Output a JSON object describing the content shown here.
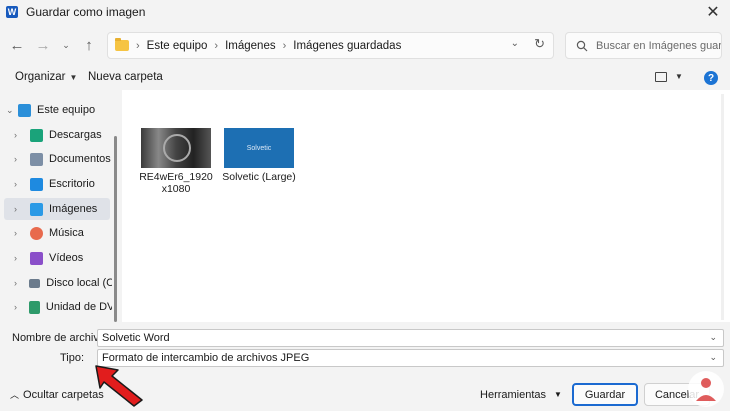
{
  "window": {
    "title": "Guardar como imagen",
    "app_icon": "W"
  },
  "nav": {
    "breadcrumbs": [
      "Este equipo",
      "Imágenes",
      "Imágenes guardadas"
    ],
    "search_placeholder": "Buscar en Imágenes guarda..."
  },
  "toolbar": {
    "organize": "Organizar",
    "new_folder": "Nueva carpeta",
    "help": "?"
  },
  "sidebar": {
    "items": [
      {
        "label": "Este equipo",
        "icon": "computer-icon",
        "color": "#2b8fd9"
      },
      {
        "label": "Descargas",
        "icon": "download-icon",
        "color": "#1aa37a"
      },
      {
        "label": "Documentos",
        "icon": "documents-icon",
        "color": "#7d8fa6"
      },
      {
        "label": "Escritorio",
        "icon": "desktop-icon",
        "color": "#1e8ae0"
      },
      {
        "label": "Imágenes",
        "icon": "pictures-icon",
        "color": "#2b9ae6"
      },
      {
        "label": "Música",
        "icon": "music-icon",
        "color": "#e86a4d"
      },
      {
        "label": "Vídeos",
        "icon": "videos-icon",
        "color": "#8a4fc9"
      },
      {
        "label": "Disco local (C:)",
        "icon": "drive-icon",
        "color": "#6b7b8c"
      },
      {
        "label": "Unidad de DVD",
        "icon": "dvd-icon",
        "color": "#2e9a6a"
      }
    ]
  },
  "files": [
    {
      "name": "RE4wEr6_1920x1080"
    },
    {
      "name": "Solvetic (Large)",
      "thumb_text": "Solvetic"
    }
  ],
  "form": {
    "filename_label": "Nombre de archivo:",
    "filename_value": "Solvetic Word",
    "type_label": "Tipo:",
    "type_value": "Formato de intercambio de archivos JPEG"
  },
  "footer": {
    "hide_folders": "Ocultar carpetas",
    "tools": "Herramientas",
    "save": "Guardar",
    "cancel": "Cancelar"
  },
  "colors": {
    "accent": "#1b6ad1",
    "arrow": "#e11d1d"
  }
}
